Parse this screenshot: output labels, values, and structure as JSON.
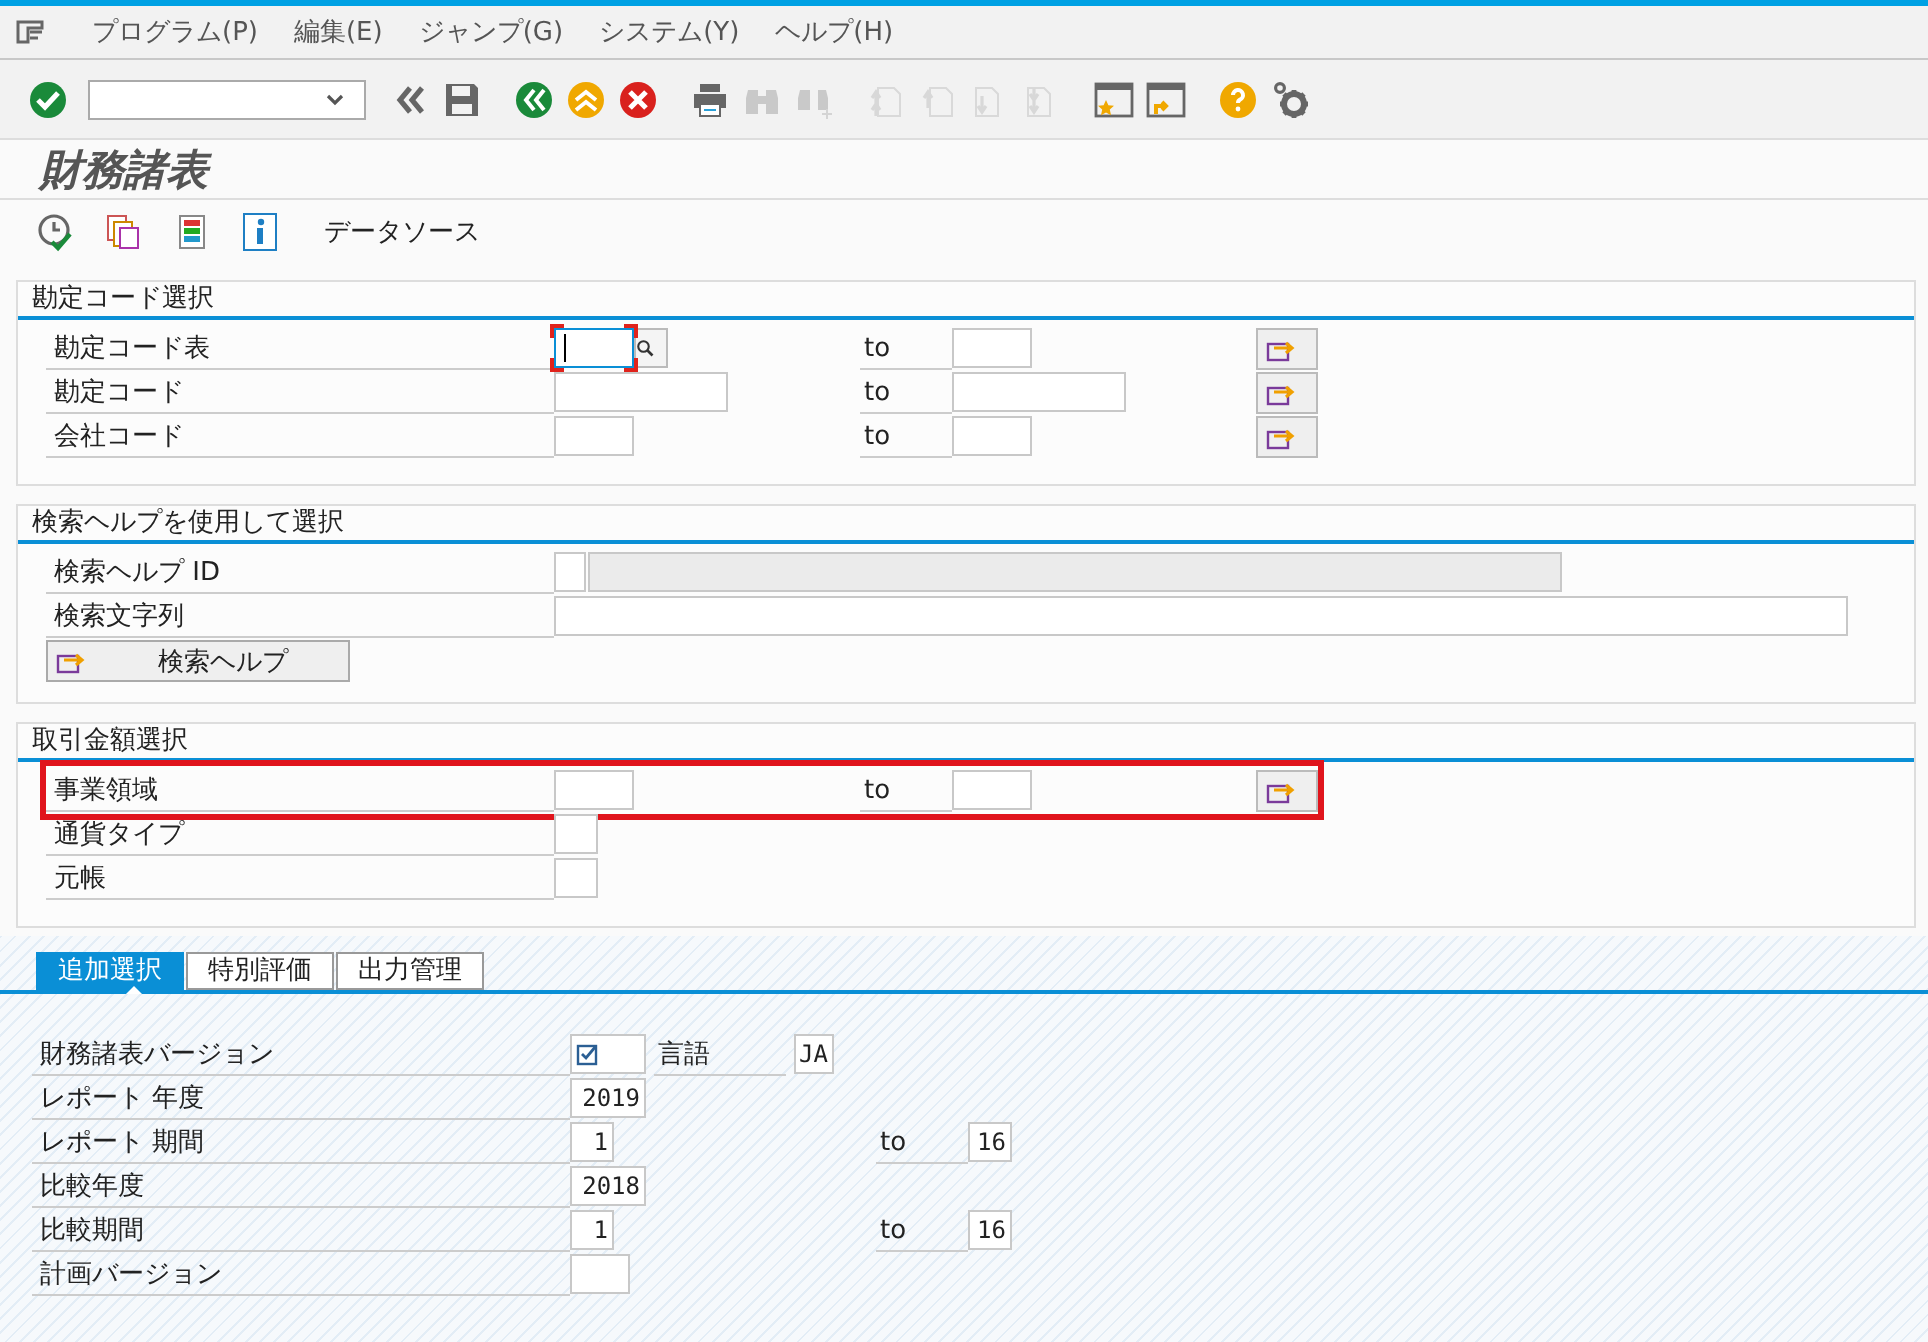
{
  "menu": [
    {
      "label": "プログラム(P)"
    },
    {
      "label": "編集(E)"
    },
    {
      "label": "ジャンプ(G)"
    },
    {
      "label": "システム(Y)"
    },
    {
      "label": "ヘルプ(H)"
    }
  ],
  "toolbar": [
    {
      "kind": "enter",
      "disabled": false
    },
    {
      "kind": "command_field",
      "disabled": false
    },
    {
      "kind": "collapse",
      "disabled": false
    },
    {
      "kind": "save",
      "disabled": false
    },
    {
      "kind": "back",
      "disabled": false
    },
    {
      "kind": "up",
      "disabled": false
    },
    {
      "kind": "cancel",
      "disabled": false
    },
    {
      "kind": "print",
      "disabled": false
    },
    {
      "kind": "find",
      "disabled": true
    },
    {
      "kind": "find_next",
      "disabled": true
    },
    {
      "kind": "first_page",
      "disabled": true
    },
    {
      "kind": "prev_page",
      "disabled": true
    },
    {
      "kind": "next_page",
      "disabled": true
    },
    {
      "kind": "last_page",
      "disabled": true
    },
    {
      "kind": "new_window",
      "disabled": false
    },
    {
      "kind": "shortcut",
      "disabled": false
    },
    {
      "kind": "help",
      "disabled": false
    },
    {
      "kind": "settings",
      "disabled": false
    }
  ],
  "title": "財務諸表",
  "app_toolbar": [
    {
      "kind": "execute"
    },
    {
      "kind": "copy"
    },
    {
      "kind": "layout"
    },
    {
      "kind": "info"
    },
    {
      "kind": "text",
      "label": "データソース"
    }
  ],
  "sections": [
    {
      "title": "勘定コード選択",
      "rows": [
        {
          "kind": "code_range",
          "label": "勘定コード表",
          "to": "to",
          "focused": true,
          "highlighted": false
        },
        {
          "kind": "account_range",
          "label": "勘定コード",
          "to": "to",
          "focused": false,
          "highlighted": false
        },
        {
          "kind": "code_range",
          "label": "会社コード",
          "to": "to",
          "focused": false,
          "highlighted": false
        }
      ]
    },
    {
      "title": "検索ヘルプを使用して選択",
      "rows": [
        {
          "kind": "search_id",
          "label": "検索ヘルプ ID"
        },
        {
          "kind": "string",
          "label": "検索文字列"
        },
        {
          "kind": "button",
          "label": "検索ヘルプ"
        }
      ]
    },
    {
      "title": "取引金額選択",
      "rows": [
        {
          "kind": "code_range",
          "label": "事業領域",
          "to": "to",
          "focused": false,
          "highlighted": true
        },
        {
          "kind": "single",
          "label": "通貨タイプ"
        },
        {
          "kind": "single",
          "label": "元帳"
        }
      ]
    }
  ],
  "tabs": [
    {
      "label": "追加選択",
      "selected": true
    },
    {
      "label": "特別評価",
      "selected": false
    },
    {
      "label": "出力管理",
      "selected": false
    }
  ],
  "tab_rows": [
    {
      "kind": "check",
      "label": "財務諸表バージョン",
      "checked": true,
      "side_label": "言語",
      "side_value": "JA"
    },
    {
      "kind": "year",
      "label": "レポート 年度",
      "value": "2019"
    },
    {
      "kind": "period_range",
      "label": "レポート 期間",
      "low": "1",
      "to": "to",
      "high": "16"
    },
    {
      "kind": "year",
      "label": "比較年度",
      "value": "2018"
    },
    {
      "kind": "period_range",
      "label": "比較期間",
      "low": "1",
      "to": "to",
      "high": "16"
    },
    {
      "kind": "plan",
      "label": "計画バージョン"
    }
  ]
}
